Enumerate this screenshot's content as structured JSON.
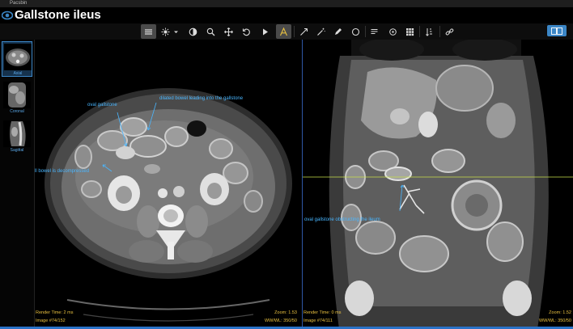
{
  "app": {
    "name": "Pacsbin"
  },
  "case": {
    "title": "Gallstone ileus"
  },
  "colors": {
    "accent": "#3b86c6",
    "annotation": "#49b6ff",
    "overlay": "#e8c040",
    "crosshair": "#c9e04a"
  },
  "toolbar": {
    "icons": [
      "stack-scroll-icon",
      "brightness-icon",
      "chevron-down-icon",
      "contrast-icon",
      "zoom-icon",
      "pan-icon",
      "rotate-icon",
      "play-icon",
      "annotate-icon",
      "arrow-icon",
      "magic-icon",
      "pencil-icon",
      "circle-icon",
      "lines-icon",
      "target-icon",
      "grid-icon",
      "sort-icon",
      "link-icon",
      "layout-icon"
    ],
    "active": [
      "stack-scroll-icon",
      "annotate-icon"
    ]
  },
  "series": [
    {
      "label": "Axial",
      "selected": true
    },
    {
      "label": "Coronal",
      "selected": false
    },
    {
      "label": "Sagittal",
      "selected": false
    }
  ],
  "viewports": {
    "left": {
      "render_time": "Render Time: 2 ms",
      "image": "Image #74/152",
      "zoom": "Zoom: 1.53",
      "wwwl": "WW/WL: 350/50",
      "annotations": [
        "oval gallstone",
        "dilated bowel leading into the gallstone",
        "ll bowel is decompressed"
      ]
    },
    "right": {
      "render_time": "Render Time: 0 ms",
      "image": "Image #74/111",
      "zoom": "Zoom: 1.52",
      "wwwl": "WW/WL: 350/50",
      "annotations": [
        "oval gallstone obstructing the ileum"
      ]
    }
  }
}
